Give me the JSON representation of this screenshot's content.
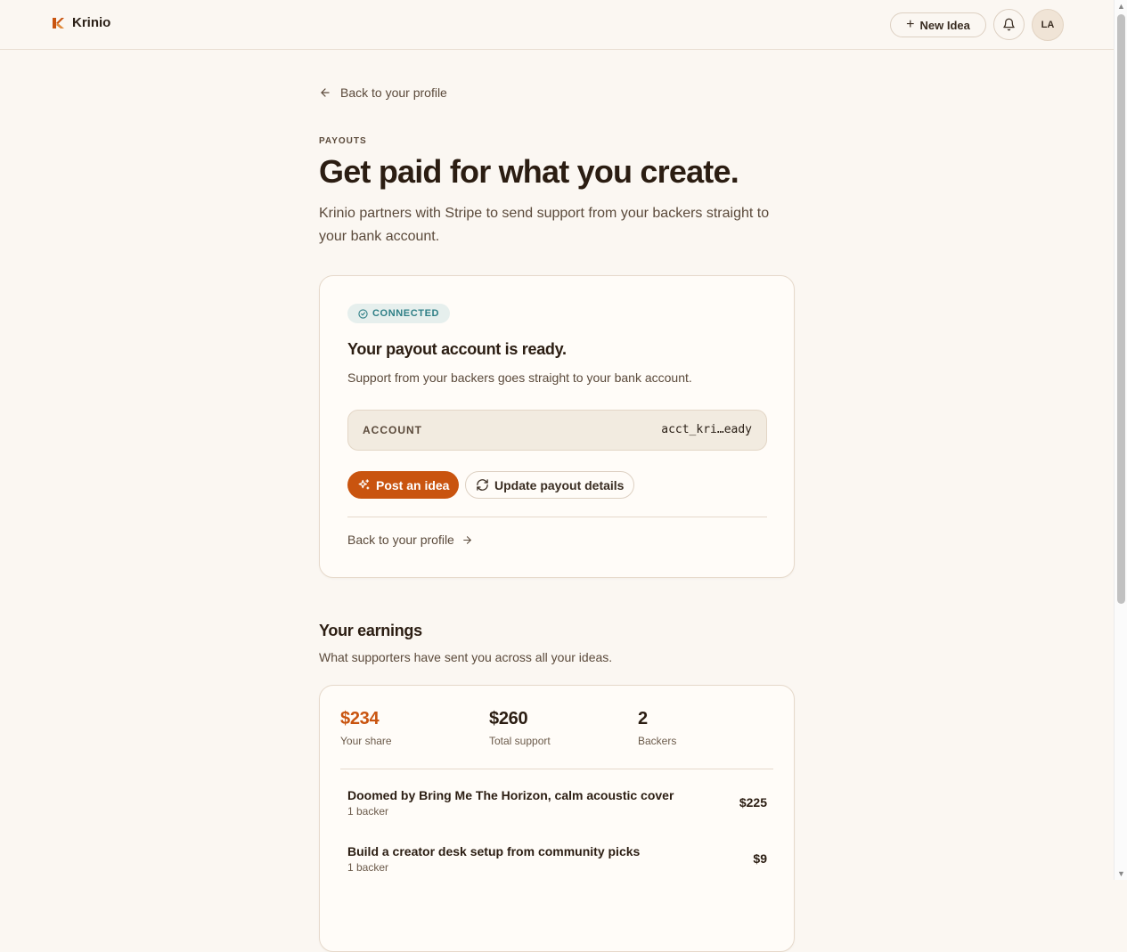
{
  "app": {
    "name": "Krinio",
    "accent": "#c9540f"
  },
  "header": {
    "new_idea_label": "New Idea",
    "avatar_initials": "LA"
  },
  "page": {
    "back_label": "Back to your profile",
    "eyebrow": "PAYOUTS",
    "title": "Get paid for what you create.",
    "subtitle": "Krinio partners with Stripe to send support from your backers straight to your bank account."
  },
  "payout_card": {
    "status_badge": "CONNECTED",
    "title": "Your payout account is ready.",
    "description": "Support from your backers goes straight to your bank account.",
    "account_label": "ACCOUNT",
    "account_value": "acct_kri…eady",
    "post_idea_label": "Post an idea",
    "update_label": "Update payout details",
    "back_label": "Back to your profile"
  },
  "earnings": {
    "title": "Your earnings",
    "subtitle": "What supporters have sent you across all your ideas.",
    "stats": [
      {
        "value": "$234",
        "label": "Your share"
      },
      {
        "value": "$260",
        "label": "Total support"
      },
      {
        "value": "2",
        "label": "Backers"
      }
    ],
    "rows": [
      {
        "title": "Doomed by Bring Me The Horizon, calm acoustic cover",
        "meta": "1 backer",
        "amount": "$225"
      },
      {
        "title": "Build a creator desk setup from community picks",
        "meta": "1 backer",
        "amount": "$9"
      }
    ]
  }
}
